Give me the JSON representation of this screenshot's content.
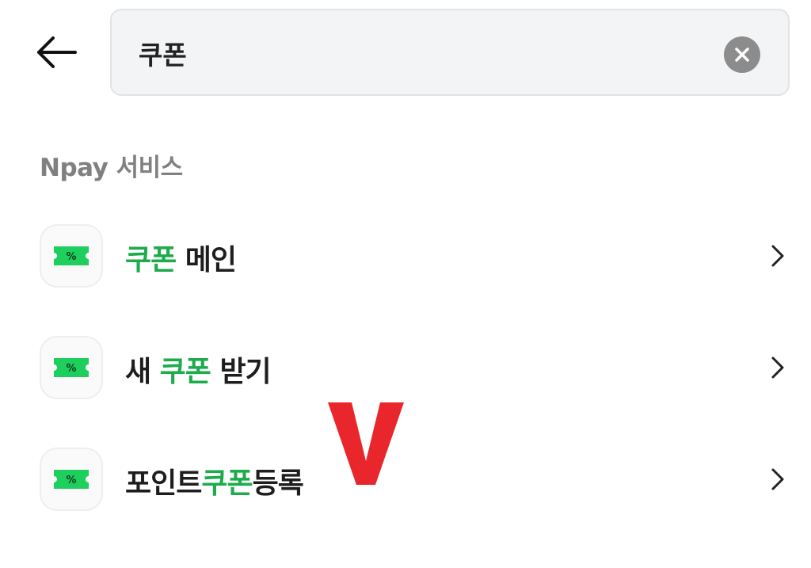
{
  "header": {
    "back_icon": "arrow-left-icon",
    "search": {
      "value": "쿠폰",
      "placeholder": "",
      "clear_icon": "clear-circle-x-icon"
    }
  },
  "section": {
    "title": "Npay 서비스"
  },
  "results": [
    {
      "icon": "coupon-ticket-icon",
      "parts": [
        "",
        "쿠폰",
        " 메인"
      ]
    },
    {
      "icon": "coupon-ticket-icon",
      "parts": [
        "새 ",
        "쿠폰",
        " 받기"
      ]
    },
    {
      "icon": "coupon-ticket-icon",
      "parts": [
        "포인트",
        "쿠폰",
        "등록"
      ]
    }
  ],
  "chevron_icon": "chevron-right-icon",
  "annotation": {
    "mark": "V",
    "color": "#e8262b"
  },
  "colors": {
    "highlight": "#1dab4c",
    "coupon_icon": "#1fcf5e",
    "clear_button": "#8c8c8c",
    "search_bg": "#f3f4f6"
  }
}
